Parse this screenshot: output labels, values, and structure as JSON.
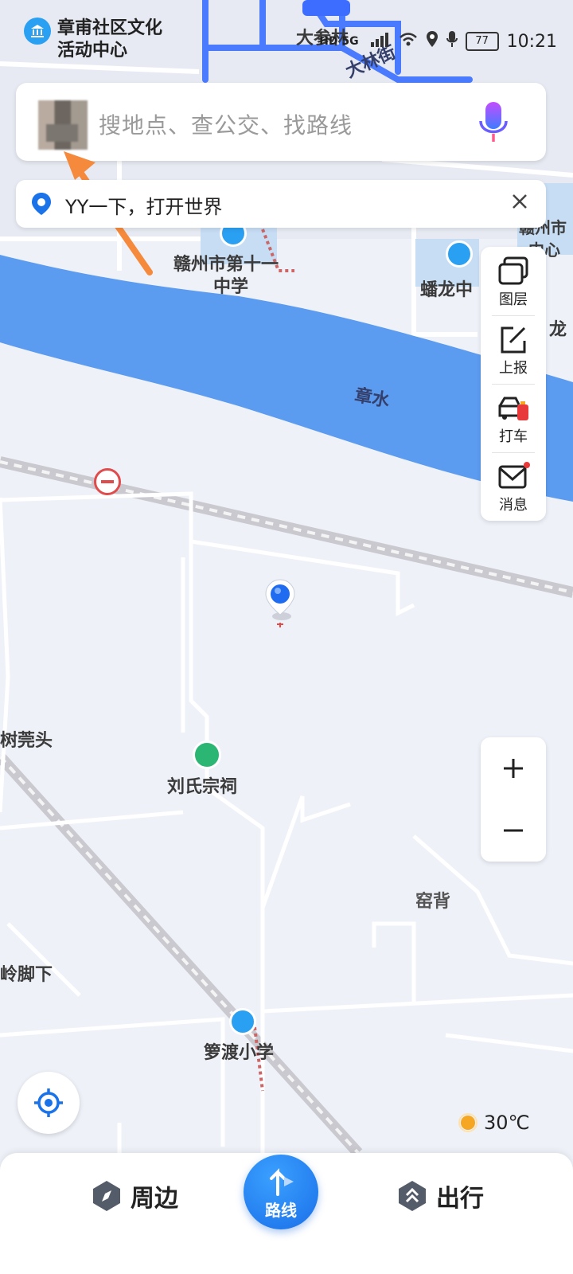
{
  "status_bar": {
    "poi_name_line1": "章甫社区文化",
    "poi_name_line2": "活动中心",
    "network": "HD 5G",
    "battery": "77",
    "time": "10:21"
  },
  "search": {
    "placeholder": "搜地点、查公交、找路线"
  },
  "banner": {
    "text": "YY一下，打开世界"
  },
  "side_tools": [
    {
      "label": "图层",
      "icon": "layers-icon"
    },
    {
      "label": "上报",
      "icon": "edit-icon"
    },
    {
      "label": "打车",
      "icon": "taxi-icon"
    },
    {
      "label": "消息",
      "icon": "mail-icon"
    }
  ],
  "map_labels": {
    "dashenlin": "大参林",
    "dalin_street": "大林街",
    "school11_line1": "赣州市第十一",
    "school11_line2": "中学",
    "panlong": "蟠龙中",
    "ganzhou_partial_1": "赣州市",
    "ganzhou_partial_2": "中心",
    "zhangshui": "章水",
    "shuwantou": "树莞头",
    "liushi_temple": "刘氏宗祠",
    "yaobei": "窑背",
    "lingjiaoxia": "岭脚下",
    "luodu_school": "箩渡小学",
    "long_partial": "龙"
  },
  "weather": {
    "temperature": "30℃"
  },
  "bottom_nav": {
    "nearby": "周边",
    "route": "路线",
    "travel": "出行"
  },
  "colors": {
    "river": "#5b9bf0",
    "accent": "#1a73e8",
    "poi_blue": "#2aa0f2",
    "poi_green": "#2bb673"
  }
}
